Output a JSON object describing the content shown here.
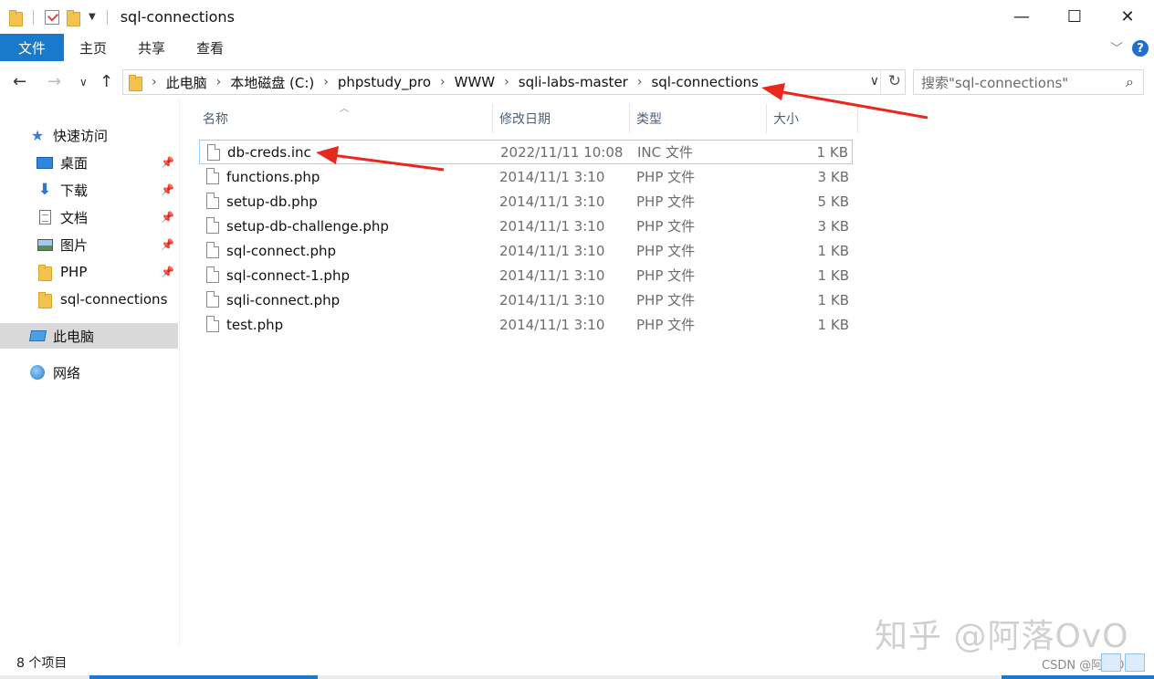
{
  "window": {
    "title": "sql-connections",
    "controls": {
      "minimize": "—",
      "maximize": "☐",
      "close": "✕"
    }
  },
  "ribbon": {
    "tabs": [
      "文件",
      "主页",
      "共享",
      "查看"
    ],
    "help": "?"
  },
  "address": {
    "crumbs": [
      "此电脑",
      "本地磁盘 (C:)",
      "phpstudy_pro",
      "WWW",
      "sqli-labs-master",
      "sql-connections"
    ],
    "separator": "›"
  },
  "search": {
    "placeholder": "搜索\"sql-connections\""
  },
  "sidebar": {
    "items": [
      {
        "label": "快速访问",
        "icon": "star-icon"
      },
      {
        "label": "桌面",
        "icon": "desktop-icon",
        "pinned": true
      },
      {
        "label": "下载",
        "icon": "download-icon",
        "pinned": true
      },
      {
        "label": "文档",
        "icon": "documents-icon",
        "pinned": true
      },
      {
        "label": "图片",
        "icon": "pictures-icon",
        "pinned": true
      },
      {
        "label": "PHP",
        "icon": "folder-icon",
        "pinned": true
      },
      {
        "label": "sql-connections",
        "icon": "folder-icon"
      },
      {
        "label": "此电脑",
        "icon": "this-pc-icon",
        "selected": true
      },
      {
        "label": "网络",
        "icon": "network-icon"
      }
    ]
  },
  "columns": {
    "name": "名称",
    "date": "修改日期",
    "type": "类型",
    "size": "大小"
  },
  "files": [
    {
      "name": "db-creds.inc",
      "date": "2022/11/11 10:08",
      "type": "INC 文件",
      "size": "1 KB",
      "selected": true
    },
    {
      "name": "functions.php",
      "date": "2014/11/1 3:10",
      "type": "PHP 文件",
      "size": "3 KB"
    },
    {
      "name": "setup-db.php",
      "date": "2014/11/1 3:10",
      "type": "PHP 文件",
      "size": "5 KB"
    },
    {
      "name": "setup-db-challenge.php",
      "date": "2014/11/1 3:10",
      "type": "PHP 文件",
      "size": "3 KB"
    },
    {
      "name": "sql-connect.php",
      "date": "2014/11/1 3:10",
      "type": "PHP 文件",
      "size": "1 KB"
    },
    {
      "name": "sql-connect-1.php",
      "date": "2014/11/1 3:10",
      "type": "PHP 文件",
      "size": "1 KB"
    },
    {
      "name": "sqli-connect.php",
      "date": "2014/11/1 3:10",
      "type": "PHP 文件",
      "size": "1 KB"
    },
    {
      "name": "test.php",
      "date": "2014/11/1 3:10",
      "type": "PHP 文件",
      "size": "1 KB"
    }
  ],
  "status": {
    "count": "8 个项目"
  },
  "watermark": {
    "text": "知乎 @阿落OvO",
    "csdn": "CSDN @阿落OvO"
  },
  "colors": {
    "accent": "#1979ca",
    "annotation": "#e8281e",
    "selection_border": "#99d1ff"
  }
}
